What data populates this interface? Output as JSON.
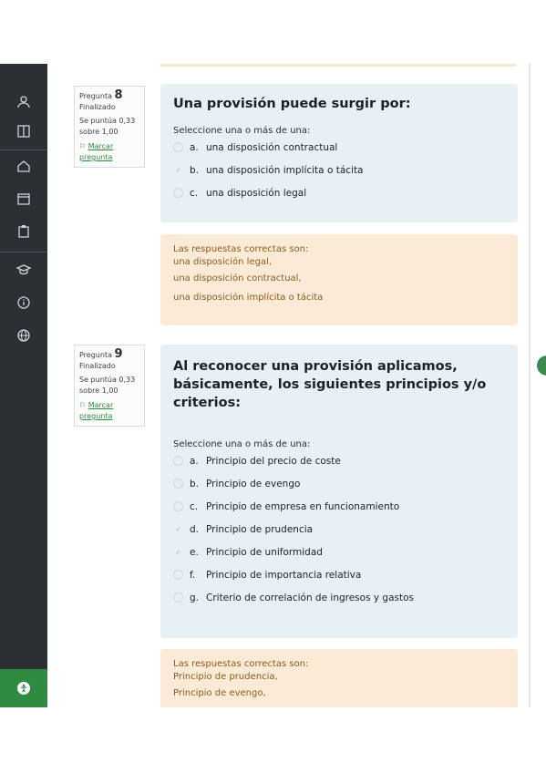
{
  "sidebar": {
    "icons": [
      "user-group-icon",
      "book-icon",
      "home-icon",
      "calendar-icon",
      "clipboard-icon",
      "graduation-cap-icon",
      "info-icon",
      "globe-icon"
    ],
    "bottom_icon": "accessibility-icon",
    "bottom_color": "#2e8b3f"
  },
  "questions": [
    {
      "number_label": "Pregunta",
      "number": "8",
      "status": "Finalizado",
      "score": "Se puntúa 0,33 sobre 1,00",
      "flag_label": "Marcar pregunta",
      "text": "Una provisión puede surgir por:",
      "prompt": "Seleccione una o más de una:",
      "options": [
        {
          "letter": "a.",
          "text": "una disposición contractual",
          "marked": false
        },
        {
          "letter": "b.",
          "text": "una disposición implícita o tácita",
          "marked": true
        },
        {
          "letter": "c.",
          "text": "una disposición legal",
          "marked": false
        }
      ],
      "feedback": [
        "Las respuestas correctas son:",
        "una disposición legal,",
        "una disposición contractual,",
        "una disposición implícita o tácita"
      ]
    },
    {
      "number_label": "Pregunta",
      "number": "9",
      "status": "Finalizado",
      "score": "Se puntúa 0,33 sobre 1,00",
      "flag_label": "Marcar pregunta",
      "text": "Al reconocer una provisión aplicamos, básicamente, los siguientes principios y/o criterios:",
      "prompt": "Seleccione una o más de una:",
      "options": [
        {
          "letter": "a.",
          "text": "Principio del precio de coste",
          "marked": false
        },
        {
          "letter": "b.",
          "text": "Principio de evengo",
          "marked": false
        },
        {
          "letter": "c.",
          "text": "Principio de empresa en funcionamiento",
          "marked": false
        },
        {
          "letter": "d.",
          "text": "Principio de prudencia",
          "marked": true
        },
        {
          "letter": "e.",
          "text": "Principio de uniformidad",
          "marked": true
        },
        {
          "letter": "f.",
          "text": "Principio de importancia relativa",
          "marked": false
        },
        {
          "letter": "g.",
          "text": "Criterio de correlación de ingresos y gastos",
          "marked": false
        }
      ],
      "feedback": [
        "Las respuestas correctas son:",
        "Principio de prudencia,",
        "Principio de evengo,"
      ]
    }
  ]
}
